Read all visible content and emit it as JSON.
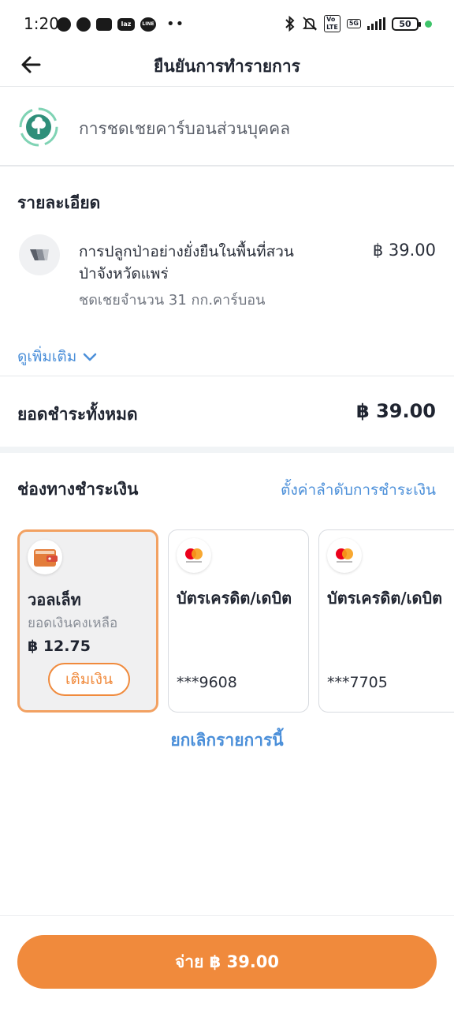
{
  "status_bar": {
    "time": "1:20",
    "dots": "••",
    "battery": "50",
    "network": "5G"
  },
  "header": {
    "title": "ยืนยันการทำรายการ"
  },
  "program": {
    "name": "การชดเชยคาร์บอนส่วนบุคคล"
  },
  "details": {
    "title": "รายละเอียด",
    "item": {
      "name": "การปลูกป่าอย่างยั่งยืนในพื้นที่สวนป่าจังหวัดแพร่",
      "sub": "ชดเชยจำนวน 31 กก.คาร์บอน",
      "price": "฿ 39.00"
    },
    "see_more": "ดูเพิ่มเติม"
  },
  "total": {
    "label": "ยอดชำระทั้งหมด",
    "amount": "฿ 39.00"
  },
  "payment": {
    "title": "ช่องทางชำระเงิน",
    "settings_link": "ตั้งค่าลำดับการชำระเงิน",
    "wallet": {
      "title": "วอลเล็ท",
      "balance_label": "ยอดเงินคงเหลือ",
      "balance": "฿ 12.75",
      "topup": "เติมเงิน"
    },
    "cards": [
      {
        "title": "บัตรเครดิต/เดบิต",
        "number": "***9608",
        "brand_icon": "mastercard-icon"
      },
      {
        "title": "บัตรเครดิต/เดบิต",
        "number": "***7705",
        "brand_icon": "mastercard-icon"
      }
    ]
  },
  "cancel": "ยกเลิกรายการนี้",
  "pay_button": "จ่าย ฿ 39.00",
  "colors": {
    "accent": "#f08a3c",
    "link": "#4b8fd9",
    "selected_border": "#f2a162"
  }
}
